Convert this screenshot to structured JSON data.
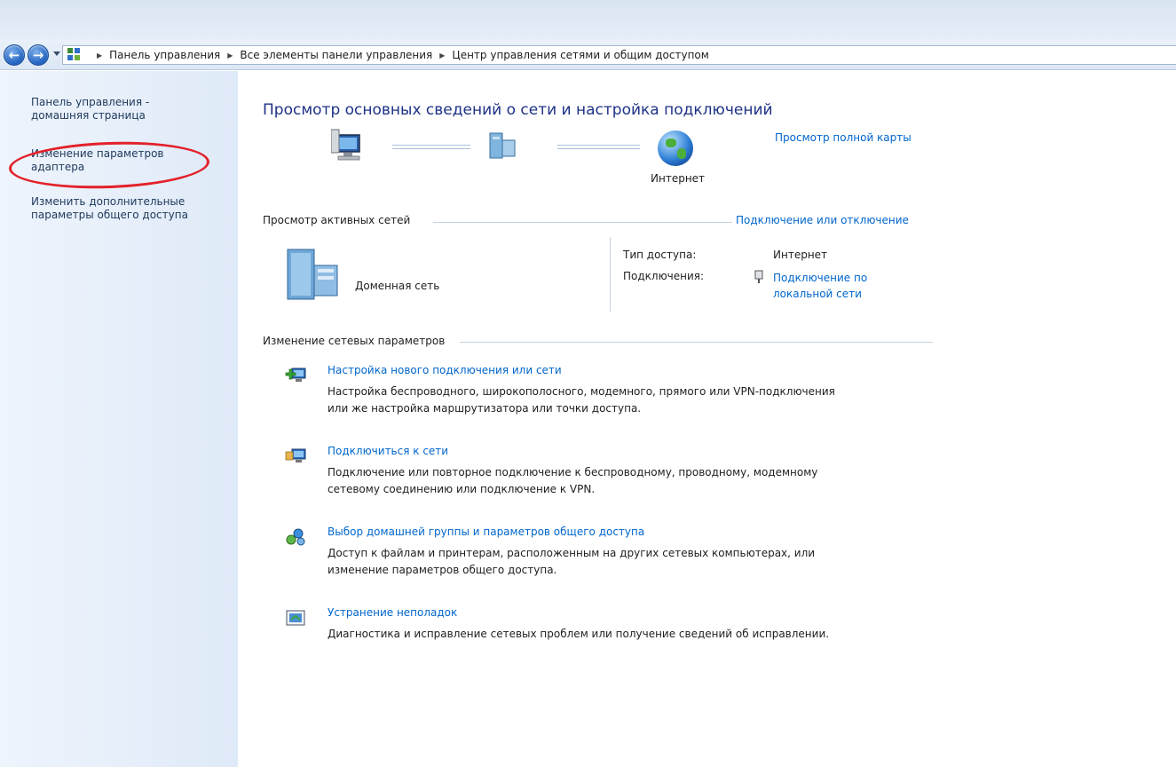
{
  "nav": {
    "back_icon": "back-arrow-icon",
    "forward_icon": "forward-arrow-icon"
  },
  "address": {
    "crumbs": [
      "Панель управления",
      "Все элементы панели управления",
      "Центр управления сетями и общим доступом"
    ]
  },
  "sidebar": {
    "items": [
      {
        "label_l1": "Панель управления -",
        "label_l2": "домашняя страница"
      },
      {
        "label_l1": "Изменение параметров",
        "label_l2": "адаптера"
      },
      {
        "label_l1": "Изменить дополнительные",
        "label_l2": "параметры общего доступа"
      }
    ]
  },
  "main": {
    "heading": "Просмотр основных сведений о сети и настройка подключений",
    "map": {
      "internet_label": "Интернет",
      "full_map_link": "Просмотр полной карты"
    },
    "active": {
      "title": "Просмотр активных сетей",
      "connect_link": "Подключение или отключение",
      "network_name": "Доменная сеть",
      "access_key": "Тип доступа:",
      "access_value": "Интернет",
      "connections_key": "Подключения:",
      "connection_link_l1": "Подключение по",
      "connection_link_l2": "локальной сети"
    },
    "change": {
      "title": "Изменение сетевых параметров",
      "tasks": [
        {
          "icon": "new-connection-icon",
          "title": "Настройка нового подключения или сети",
          "desc1": "Настройка беспроводного, широкополосного, модемного, прямого или VPN-подключения",
          "desc2": "или же настройка маршрутизатора или точки доступа."
        },
        {
          "icon": "connect-network-icon",
          "title": "Подключиться к сети",
          "desc1": "Подключение или повторное подключение к беспроводному, проводному, модемному",
          "desc2": "сетевому соединению или подключение к VPN."
        },
        {
          "icon": "homegroup-icon",
          "title": "Выбор домашней группы и параметров общего доступа",
          "desc1": "Доступ к файлам и принтерам, расположенным на других сетевых компьютерах, или",
          "desc2": "изменение параметров общего доступа."
        },
        {
          "icon": "troubleshoot-icon",
          "title": "Устранение неполадок",
          "desc1": "Диагностика и исправление сетевых проблем или получение сведений об исправлении.",
          "desc2": ""
        }
      ]
    }
  }
}
